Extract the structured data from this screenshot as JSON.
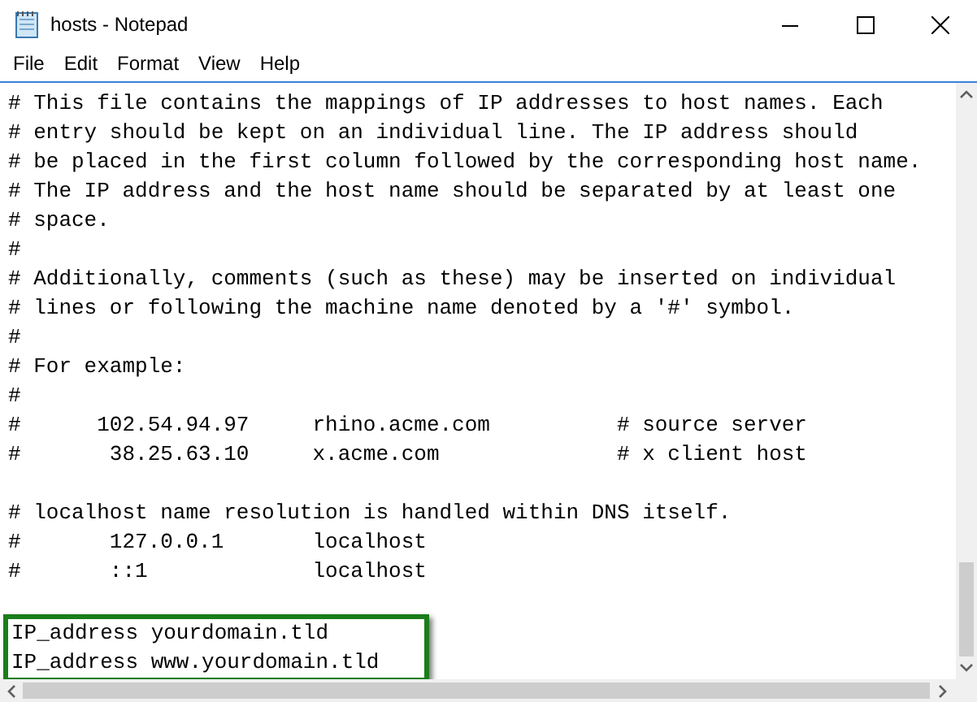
{
  "window": {
    "title": "hosts - Notepad"
  },
  "menu": [
    "File",
    "Edit",
    "Format",
    "View",
    "Help"
  ],
  "lines": [
    {
      "kind": "text",
      "text": "# This file contains the mappings of IP addresses to host names. Each"
    },
    {
      "kind": "text",
      "text": "# entry should be kept on an individual line. The IP address should"
    },
    {
      "kind": "text",
      "text": "# be placed in the first column followed by the corresponding host name."
    },
    {
      "kind": "text",
      "text": "# The IP address and the host name should be separated by at least one"
    },
    {
      "kind": "text",
      "text": "# space."
    },
    {
      "kind": "text",
      "text": "#"
    },
    {
      "kind": "text",
      "text": "# Additionally, comments (such as these) may be inserted on individual"
    },
    {
      "kind": "text",
      "text": "# lines or following the machine name denoted by a '#' symbol."
    },
    {
      "kind": "text",
      "text": "#"
    },
    {
      "kind": "text",
      "text": "# For example:"
    },
    {
      "kind": "text",
      "text": "#"
    },
    {
      "kind": "text",
      "text": "#      102.54.94.97     rhino.acme.com          # source server"
    },
    {
      "kind": "text",
      "text": "#       38.25.63.10     x.acme.com              # x client host"
    },
    {
      "kind": "blank"
    },
    {
      "kind": "text",
      "text": "# localhost name resolution is handled within DNS itself."
    },
    {
      "kind": "text",
      "text": "#\t127.0.0.1       localhost"
    },
    {
      "kind": "text",
      "text": "#\t::1             localhost"
    },
    {
      "kind": "blank"
    }
  ],
  "highlighted_lines": [
    "IP_address yourdomain.tld",
    "IP_address www.yourdomain.tld"
  ]
}
